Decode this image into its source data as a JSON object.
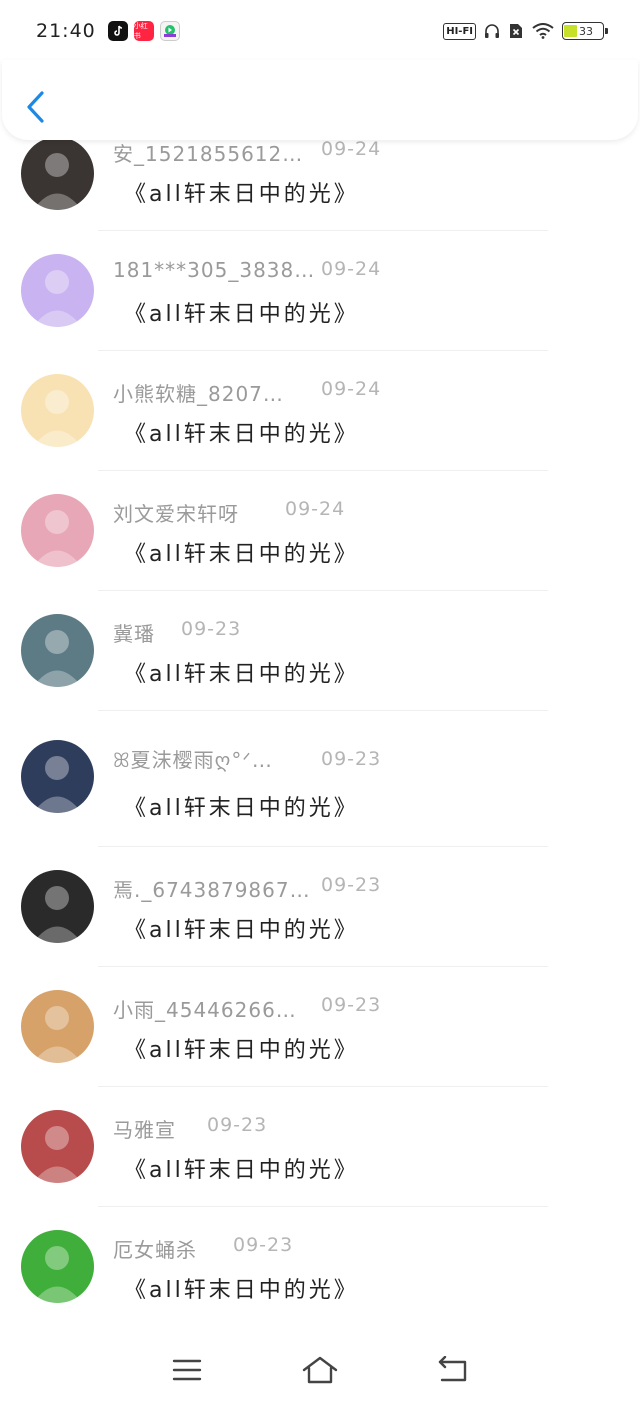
{
  "status_bar": {
    "time": "21:40",
    "hifi_label": "HI-FI",
    "battery_level": "33",
    "apps": [
      {
        "icon": "douyin-icon"
      },
      {
        "icon": "xiaohongshu-icon",
        "label": "小红书"
      },
      {
        "icon": "video-app-icon"
      }
    ]
  },
  "header": {
    "back_icon": "chevron-left-icon"
  },
  "rows": [
    {
      "name": "安_1521855612…",
      "date": "09-24",
      "title": "《all轩末日中的光》",
      "avatar": "#3a3432"
    },
    {
      "name": "181***305_3838…",
      "date": "09-24",
      "title": "《all轩末日中的光》",
      "avatar": "#c9b3f0"
    },
    {
      "name": "小熊软糖_8207…",
      "date": "09-24",
      "title": "《all轩末日中的光》",
      "avatar": "#f8e2b4"
    },
    {
      "name": "刘文爱宋轩呀",
      "date": "09-24",
      "title": "《all轩末日中的光》",
      "avatar": "#e7a7b6"
    },
    {
      "name": "冀璠",
      "date": "09-23",
      "title": "《all轩末日中的光》",
      "avatar": "#5c7b85"
    },
    {
      "name": "ꕤ夏沫樱雨ღ°ᐟ…",
      "date": "09-23",
      "title": "《all轩末日中的光》",
      "avatar": "#2f3d5c"
    },
    {
      "name": "焉._6743879867…",
      "date": "09-23",
      "title": "《all轩末日中的光》",
      "avatar": "#2a2a2a"
    },
    {
      "name": "小雨_45446266…",
      "date": "09-23",
      "title": "《all轩末日中的光》",
      "avatar": "#d6a26a"
    },
    {
      "name": "马雅宣",
      "date": "09-23",
      "title": "《all轩末日中的光》",
      "avatar": "#b84c4c"
    },
    {
      "name": "厄女蛹杀",
      "date": "09-23",
      "title": "《all轩末日中的光》",
      "avatar": "#3fae3a"
    }
  ],
  "nav": {
    "menu_icon": "menu-icon",
    "home_icon": "home-icon",
    "back_icon": "back-arrow-icon"
  },
  "colors": {
    "accent_blue": "#1e88e5",
    "name_gray": "#9a9a9a",
    "date_gray": "#b5b5b5",
    "title_black": "#222222"
  }
}
